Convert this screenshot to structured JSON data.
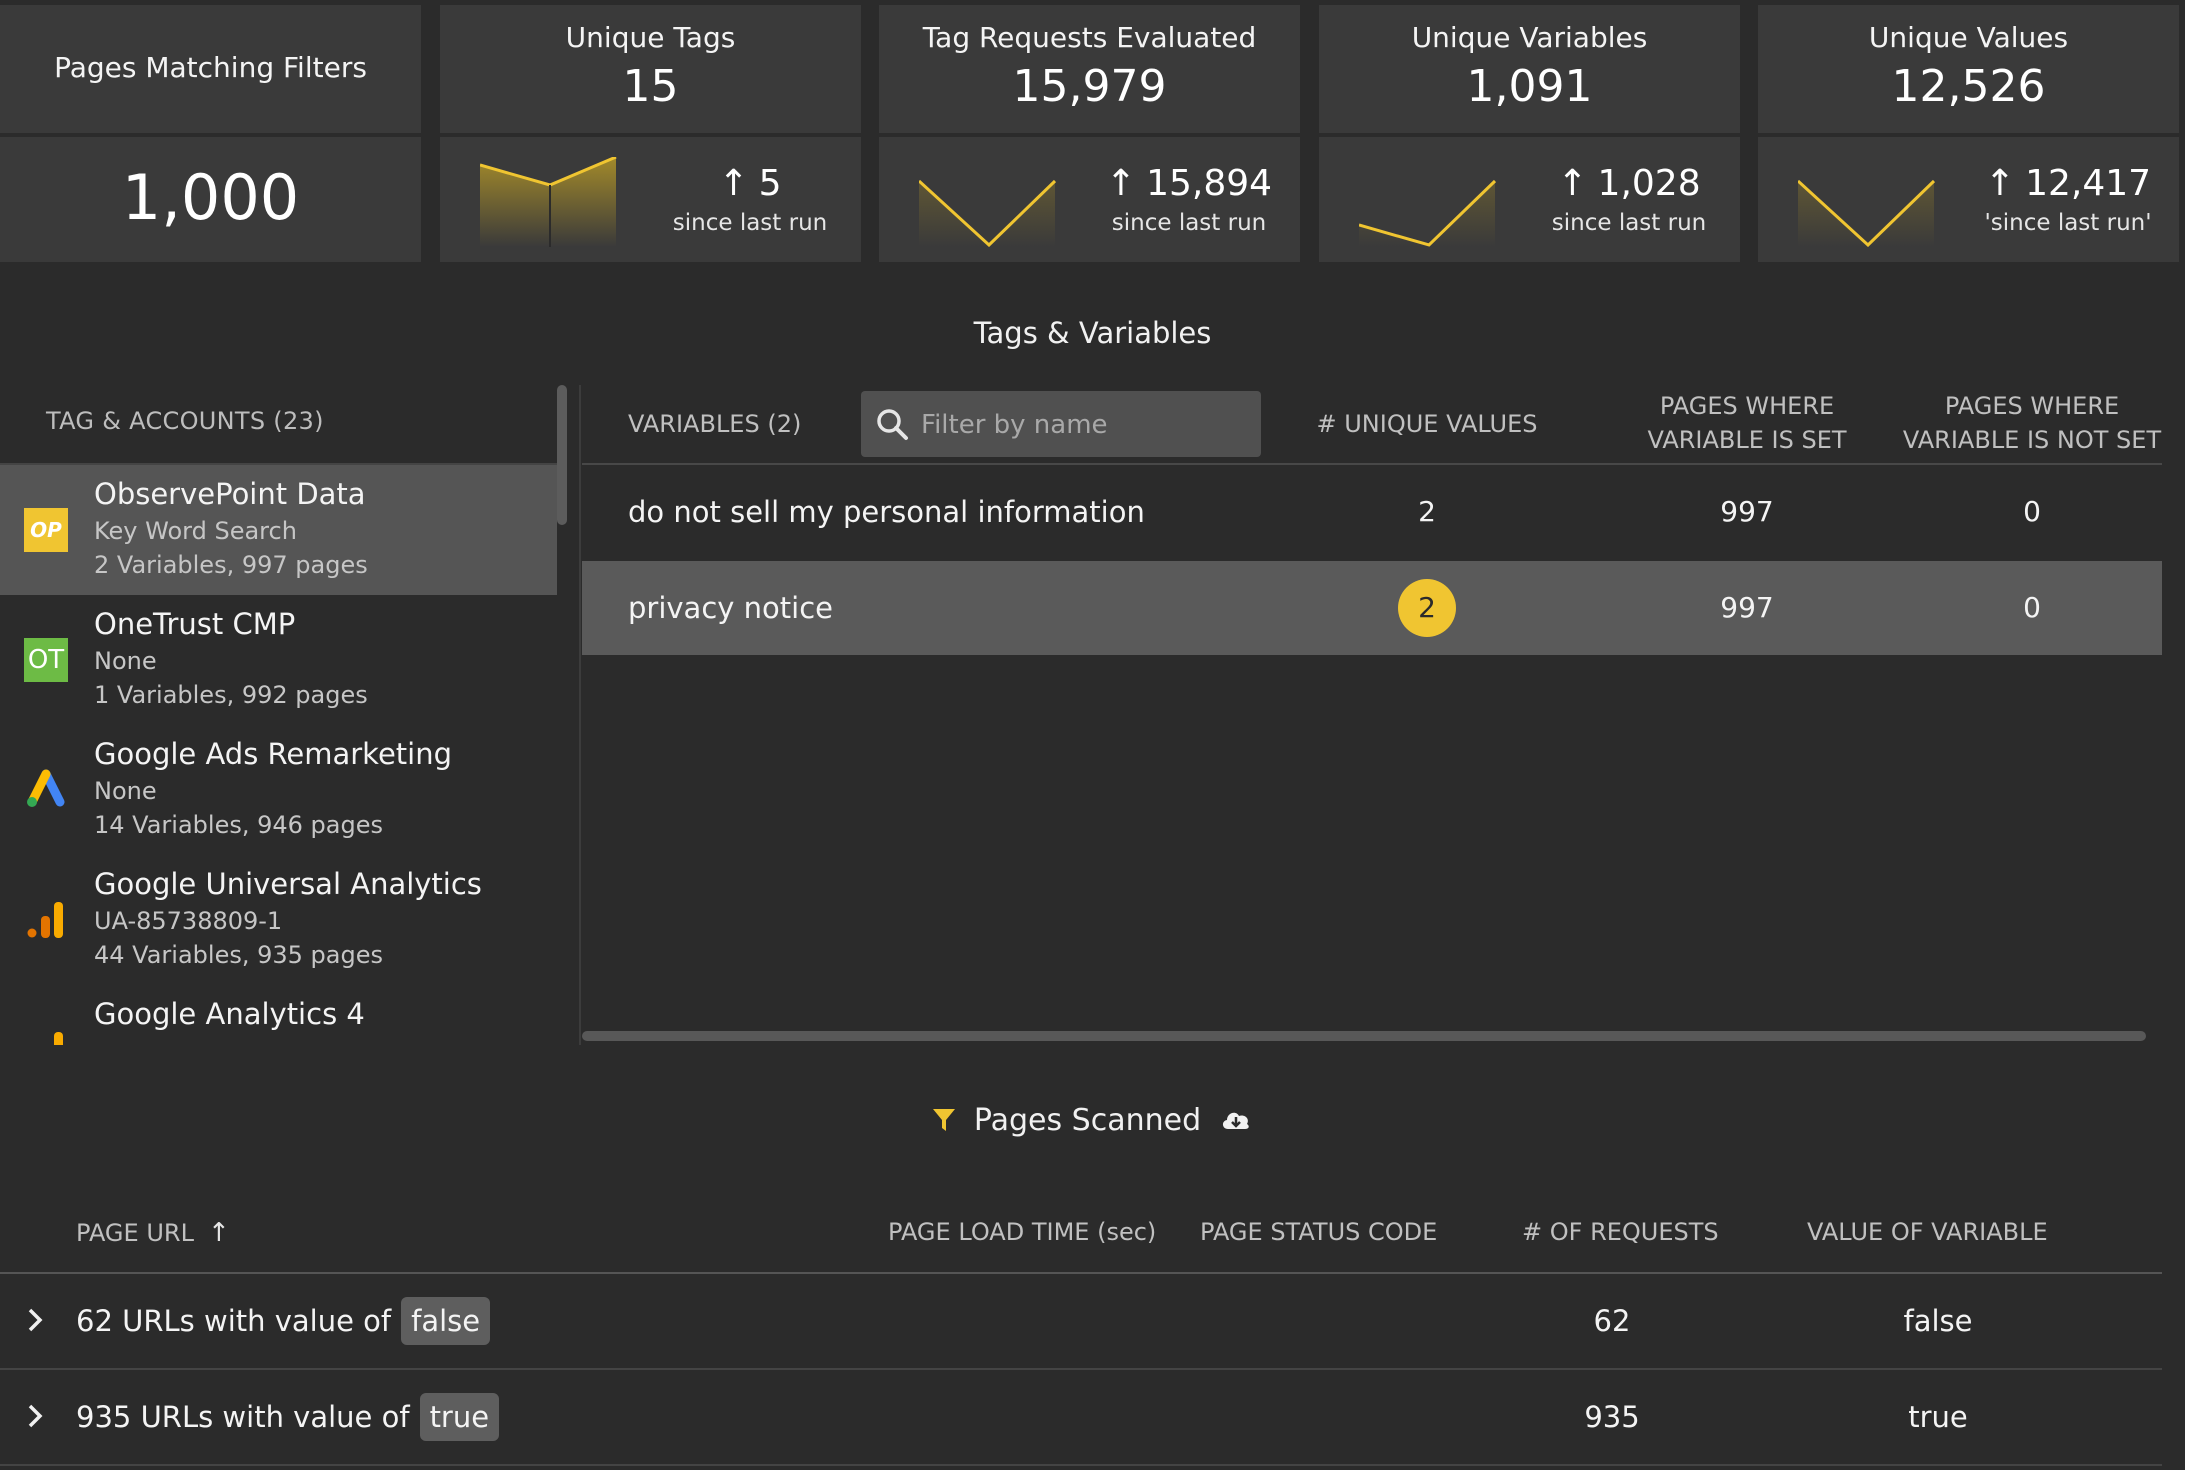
{
  "summary": {
    "pages_matching": {
      "title": "Pages Matching Filters",
      "value": "1,000"
    },
    "cards": [
      {
        "title": "Unique Tags",
        "value": "15",
        "delta": "5",
        "delta_label": "since last run"
      },
      {
        "title": "Tag Requests Evaluated",
        "value": "15,979",
        "delta": "15,894",
        "delta_label": "since last run"
      },
      {
        "title": "Unique Variables",
        "value": "1,091",
        "delta": "1,028",
        "delta_label": "since last run"
      },
      {
        "title": "Unique Values",
        "value": "12,526",
        "delta": "12,417",
        "delta_label": "'since last run'"
      }
    ],
    "accent_color": "#f0c531"
  },
  "tags_variables": {
    "title": "Tags & Variables",
    "left_header": "TAG & ACCOUNTS (23)",
    "tags": [
      {
        "name": "ObservePoint Data",
        "account": "Key Word Search",
        "stats": "2 Variables, 997 pages",
        "icon": "observepoint-icon",
        "icon_text": "OP",
        "selected": true
      },
      {
        "name": "OneTrust CMP",
        "account": "None",
        "stats": "1 Variables, 992 pages",
        "icon": "onetrust-icon",
        "icon_text": "OT",
        "selected": false
      },
      {
        "name": "Google Ads Remarketing",
        "account": "None",
        "stats": "14 Variables, 946 pages",
        "icon": "google-ads-icon",
        "selected": false
      },
      {
        "name": "Google Universal Analytics",
        "account": "UA-85738809-1",
        "stats": "44 Variables, 935 pages",
        "icon": "google-analytics-icon",
        "selected": false
      },
      {
        "name": "Google Analytics 4",
        "account": "",
        "stats": "",
        "icon": "google-analytics-icon",
        "selected": false
      }
    ],
    "variables_header": "VARIABLES (2)",
    "search_placeholder": "Filter by name",
    "col_unique": "# UNIQUE VALUES",
    "col_set_1": "PAGES WHERE",
    "col_set_2": "VARIABLE IS SET",
    "col_notset_1": "PAGES WHERE",
    "col_notset_2": "VARIABLE IS NOT SET",
    "variables": [
      {
        "name": "do not sell my personal information",
        "unique": "2",
        "set": "997",
        "not_set": "0",
        "selected": false
      },
      {
        "name": "privacy notice",
        "unique": "2",
        "set": "997",
        "not_set": "0",
        "selected": true
      }
    ]
  },
  "pages_scanned": {
    "title": "Pages Scanned",
    "col_url": "PAGE URL",
    "col_load": "PAGE LOAD TIME (sec)",
    "col_status": "PAGE STATUS CODE",
    "col_requests": "# OF REQUESTS",
    "col_value": "VALUE OF VARIABLE",
    "rows": [
      {
        "label": "62 URLs with value of",
        "pill": "false",
        "requests": "62",
        "value": "false"
      },
      {
        "label": "935 URLs with value of",
        "pill": "true",
        "requests": "935",
        "value": "true"
      }
    ]
  }
}
